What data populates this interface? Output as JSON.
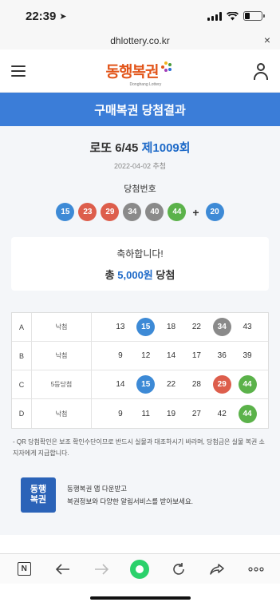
{
  "status_bar": {
    "time": "22:39"
  },
  "url_bar": {
    "url": "dhlottery.co.kr",
    "close_glyph": "×"
  },
  "header": {
    "logo_text": "동행복권",
    "logo_sub": "Donghang Lottery",
    "menu_icon": "menu-icon",
    "user_icon": "user-icon"
  },
  "page": {
    "title": "구매복권 당첨결과",
    "game": "로또 6/45",
    "round": "제1009회",
    "draw_date": "2022-04-02 추첨",
    "winning_label": "당첨번호",
    "winning_numbers": [
      15,
      23,
      29,
      34,
      40,
      44
    ],
    "plus": "+",
    "bonus_number": 20,
    "congrats": "축하합니다!",
    "prize_prefix": "총",
    "prize_amount": "5,000원",
    "prize_suffix": "당첨"
  },
  "picks": [
    {
      "letter": "A",
      "status": "낙첨",
      "numbers": [
        13,
        15,
        18,
        22,
        34,
        43
      ]
    },
    {
      "letter": "B",
      "status": "낙첨",
      "numbers": [
        9,
        12,
        14,
        17,
        36,
        39
      ]
    },
    {
      "letter": "C",
      "status": "5등당첨",
      "numbers": [
        14,
        15,
        22,
        28,
        29,
        44
      ]
    },
    {
      "letter": "D",
      "status": "낙첨",
      "numbers": [
        9,
        11,
        19,
        27,
        42,
        44
      ]
    }
  ],
  "notice": "- QR 당첨확인은 보조 확인수단이므로 반드시 실물과 대조하시기 바라며, 당첨금은 실물 복권 소지자에게 지급합니다.",
  "promo": {
    "logo_line1": "동행",
    "logo_line2": "복권",
    "line1": "동행복권 앱 다운받고",
    "line2": "복권정보와 다양한 알림서비스를 받아보세요."
  },
  "toolbar": {
    "items": [
      "n-icon",
      "back-arrow-icon",
      "forward-arrow-icon",
      "home-dot-icon",
      "reload-icon",
      "share-icon",
      "more-icon"
    ]
  },
  "colors": {
    "band_blue": "#3b7dd8",
    "ball_blue": "#3d8ad6",
    "ball_red": "#dd5e4c",
    "ball_gray": "#8a8a8a",
    "ball_green": "#5bb24a",
    "round_blue": "#1e6ac8"
  }
}
